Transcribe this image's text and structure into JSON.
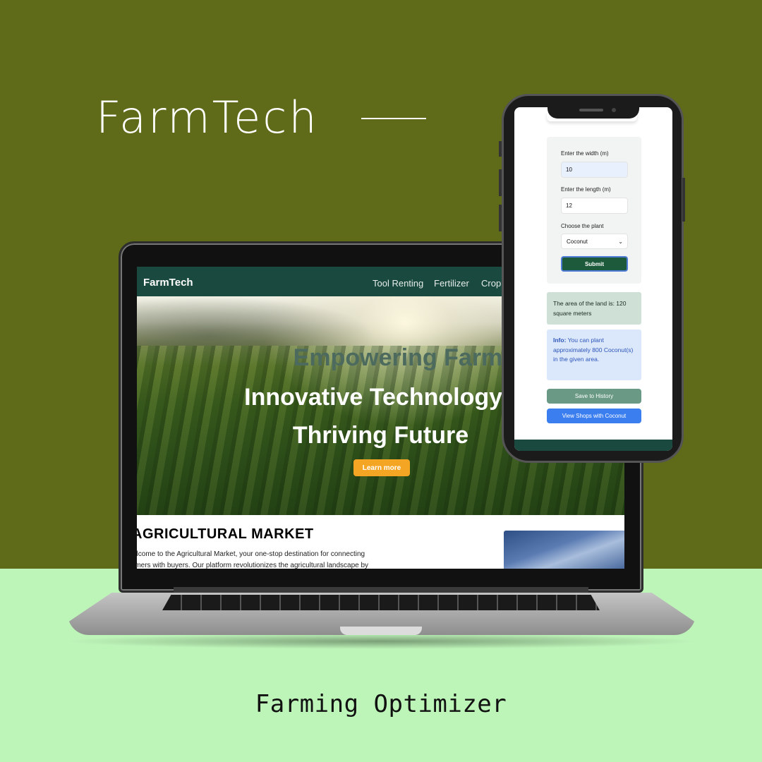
{
  "poster": {
    "title": "FarmTech",
    "caption": "Farming Optimizer",
    "colors": {
      "top_bg": "#5f6b18",
      "bottom_bg": "#bdf4b8"
    }
  },
  "website": {
    "logo": "FarmTech",
    "nav": [
      "Tool Renting",
      "Fertilizer",
      "Crop"
    ],
    "hero": {
      "line1": "Empowering Farmers",
      "line2": "Innovative Technology f",
      "line3": "Thriving Future",
      "button": "Learn more"
    },
    "market": {
      "title": "AGRICULTURAL MARKET",
      "text_line1": "elcome to the Agricultural Market, your one-stop destination for connecting",
      "text_line2": "rmers with buyers. Our platform revolutionizes the agricultural landscape by"
    },
    "colors": {
      "nav_bg": "#1a4a3f",
      "button": "#f5a524"
    }
  },
  "mobile_app": {
    "width_label": "Enter the width (m)",
    "width_value": "10",
    "length_label": "Enter the length (m)",
    "length_value": "12",
    "plant_label": "Choose the plant",
    "plant_selected": "Coconut",
    "submit": "Submit",
    "result": "The area of the land is: 120 square meters",
    "info_label": "Info:",
    "info_text": "You can plant approximately 800 Coconut(s) in the given area.",
    "save_button": "Save to History",
    "shops_button": "View Shops with Coconut",
    "colors": {
      "submit": "#1c5a3b",
      "save": "#6a9a85",
      "shops": "#3b7ef0"
    }
  }
}
